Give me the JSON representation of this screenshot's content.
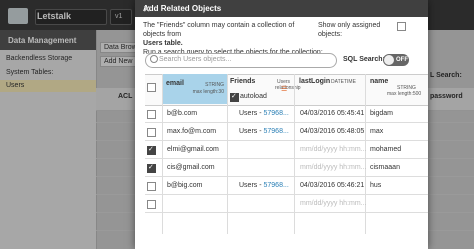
{
  "app": {
    "name": "Letstalk",
    "version": "v1",
    "section": "Data Management",
    "tabs": [
      "Data Brows",
      "Add New"
    ],
    "storage": "Backendless Storage",
    "system_tables_label": "System Tables:",
    "users_label": "Users",
    "acl_label": "ACL",
    "sql_search_bg": "L Search:",
    "password_col": "password"
  },
  "modal": {
    "title": "Add Related Objects",
    "description_lines": [
      "The \"Friends\" column may contain a collection of objects from",
      "Users table.",
      "Run a search query to select the objects for the collection:"
    ],
    "show_assigned": "Show only assigned objects:",
    "search_placeholder": "Search Users objects...",
    "sql_search_label": "SQL Search:",
    "toggle_label": "OFF",
    "columns": {
      "email": {
        "name": "email",
        "type": "STRING",
        "sub": "max length:30"
      },
      "friends": {
        "name": "Friends",
        "sub1": "Users",
        "sub2": "relationship",
        "autoload": "autoload"
      },
      "lastlogin": {
        "name": "lastLogin",
        "type": "DATETIME"
      },
      "name": {
        "name": "name",
        "type": "STRING",
        "sub": "max length:500"
      }
    },
    "rows": [
      {
        "checked": false,
        "email": "b@b.com",
        "friends": "Users - ",
        "friends_id": "57968...",
        "lastlogin": "04/03/2016 05:45:41",
        "name": "bigdam"
      },
      {
        "checked": false,
        "email": "max.fo@m.com",
        "friends": "Users - ",
        "friends_id": "57968...",
        "lastlogin": "04/03/2016 05:48:05",
        "name": "max"
      },
      {
        "checked": true,
        "email": "elmi@gmail.com",
        "friends": "",
        "friends_id": "",
        "lastlogin": "mm/dd/yyyy hh:mm...",
        "name": "mohamed"
      },
      {
        "checked": true,
        "email": "cis@gmail.com",
        "friends": "",
        "friends_id": "",
        "lastlogin": "mm/dd/yyyy hh:mm...",
        "name": "cismaaan"
      },
      {
        "checked": false,
        "email": "b@big.com",
        "friends": "Users - ",
        "friends_id": "57968...",
        "lastlogin": "04/03/2016 05:46:21",
        "name": "hus"
      },
      {
        "checked": false,
        "email": "",
        "friends": "",
        "friends_id": "",
        "lastlogin": "mm/dd/yyyy hh:mm...",
        "name": ""
      }
    ]
  }
}
